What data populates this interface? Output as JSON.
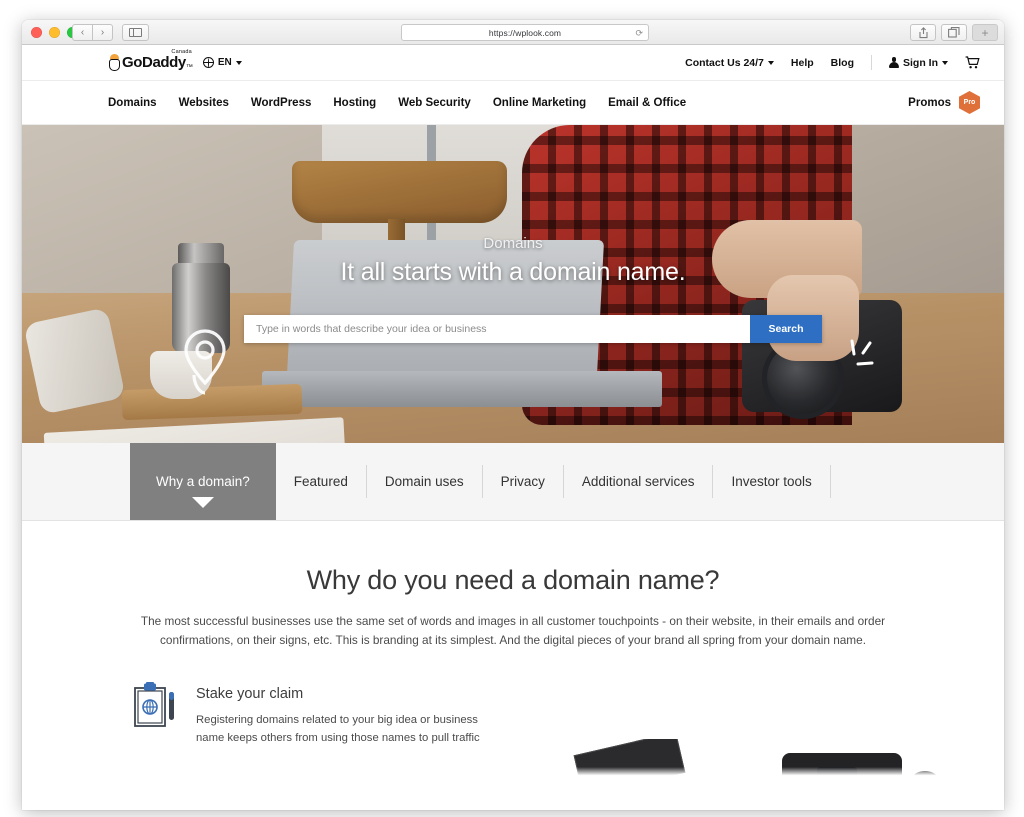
{
  "browser": {
    "url": "https://wplook.com",
    "back_icon": "chevron-left-icon",
    "forward_icon": "chevron-right-icon",
    "sidebar_icon": "sidebar-toggle-icon",
    "reload_icon": "reload-icon",
    "share_icon": "share-icon",
    "tabs_icon": "show-tabs-icon",
    "newtab_label": "+"
  },
  "site": {
    "logo": {
      "wordmark": "GoDaddy",
      "tm": "™",
      "country": "Canada"
    },
    "language": {
      "label": "EN",
      "globe_icon": "globe-icon",
      "caret_icon": "chevron-down-icon"
    },
    "utility_nav": [
      {
        "label": "Contact Us 24/7",
        "has_caret": true
      },
      {
        "label": "Help",
        "has_caret": false
      },
      {
        "label": "Blog",
        "has_caret": false
      }
    ],
    "account": {
      "label": "Sign In",
      "person_icon": "person-icon",
      "caret_icon": "chevron-down-icon",
      "cart_icon": "shopping-cart-icon"
    },
    "main_nav": [
      "Domains",
      "Websites",
      "WordPress",
      "Hosting",
      "Web Security",
      "Online Marketing",
      "Email & Office"
    ],
    "promos": {
      "label": "Promos",
      "badge": "Pro",
      "badge_color": "#e0703a"
    }
  },
  "hero": {
    "eyebrow": "Domains",
    "title": "It all starts with a domain name.",
    "search": {
      "placeholder": "Type in words that describe your idea or business",
      "value": "",
      "button_label": "Search",
      "button_color": "#2e6fc4"
    },
    "overlays": {
      "rocket_icon": "rocket-pin-icon",
      "sparkle_icon": "sparkle-icon"
    }
  },
  "tabs": {
    "active_index": 0,
    "active_color": "#808080",
    "items": [
      "Why a domain?",
      "Featured",
      "Domain uses",
      "Privacy",
      "Additional services",
      "Investor tools"
    ]
  },
  "content": {
    "title": "Why do you need a domain name?",
    "body": "The most successful businesses use the same set of words and images in all customer touchpoints - on their website, in their emails and order confirmations, on their signs, etc. This is branding at its simplest. And the digital pieces of your brand all spring from your domain name.",
    "features": [
      {
        "icon": "clipboard-globe-icon",
        "icon_color": "#3b6fb5",
        "title": "Stake your claim",
        "description": "Registering domains related to your big idea or business name keeps others from using those names to pull traffic"
      }
    ]
  }
}
